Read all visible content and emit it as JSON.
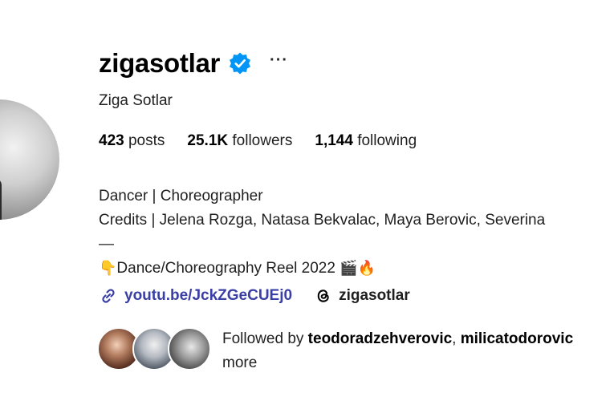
{
  "profile": {
    "username": "zigasotlar",
    "full_name": "Ziga Sotlar",
    "verified": true,
    "more_options_label": "···"
  },
  "stats": {
    "posts_count": "423",
    "posts_label": "posts",
    "followers_count": "25.1K",
    "followers_label": "followers",
    "following_count": "1,144",
    "following_label": "following"
  },
  "bio": {
    "line1": "Dancer | Choreographer",
    "line2": "Credits | Jelena Rozga, Natasa Bekvalac, Maya Berovic, Severina",
    "line3": "—",
    "line4_emoji_lead": "👇",
    "line4_text": "Dance/Choreography Reel 2022 ",
    "line4_emoji_trail": "🎬🔥"
  },
  "links": {
    "url": "youtu.be/JckZGeCUEj0",
    "threads_handle": "zigasotlar"
  },
  "followed_by": {
    "prefix": "Followed by ",
    "user1": "teodoradzehverovic",
    "separator": ", ",
    "user2": "milicatodorovic",
    "suffix": "more"
  },
  "colors": {
    "verified_badge": "#0095f6",
    "link_text": "#3a3fa6"
  },
  "icons": [
    "verified-badge-icon",
    "more-options-icon",
    "link-icon",
    "threads-icon"
  ]
}
